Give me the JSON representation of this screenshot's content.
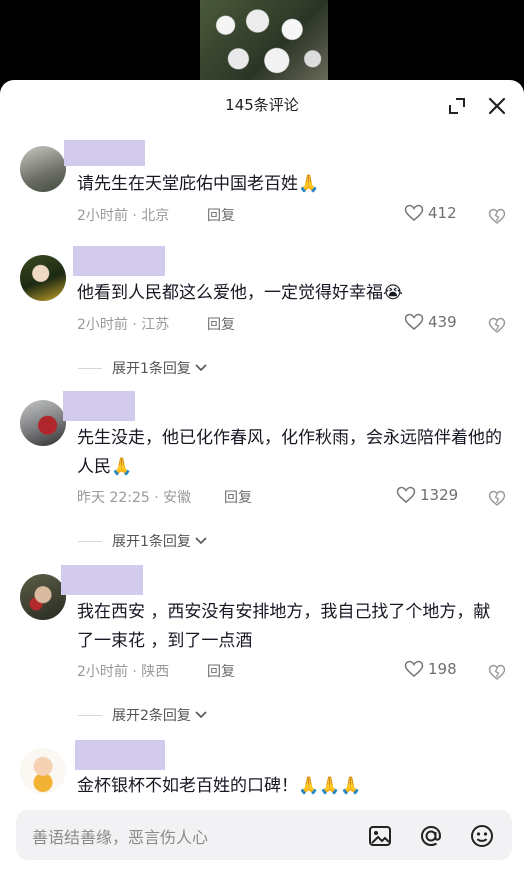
{
  "header": {
    "title": "145条评论"
  },
  "comments": [
    {
      "text": "请先生在天堂庇佑中国老百姓",
      "emoji": "🙏",
      "time_location": "2小时前 · 北京",
      "reply": "回复",
      "likes": "412"
    },
    {
      "text": "他看到人民都这么爱他，一定觉得好幸福",
      "emoji": "😭",
      "time_location": "2小时前 · 江苏",
      "reply": "回复",
      "likes": "439",
      "expand": "展开1条回复"
    },
    {
      "text": "先生没走，他已化作春风，化作秋雨，会永远陪伴着他的人民",
      "emoji": "🙏",
      "time_location": "昨天 22:25 · 安徽",
      "reply": "回复",
      "likes": "1329",
      "expand": "展开1条回复"
    },
    {
      "text": "我在西安 ，西安没有安排地方，我自己找了个地方，献了一束花 ，到了一点酒",
      "emoji": "",
      "time_location": "2小时前 · 陕西",
      "reply": "回复",
      "likes": "198",
      "expand": "展开2条回复"
    },
    {
      "text": "金杯银杯不如老百姓的口碑！",
      "emoji": "🙏🙏🙏",
      "time_location": "",
      "reply": "",
      "likes": ""
    }
  ],
  "input": {
    "placeholder": "善语结善缘，恶言伤人心"
  },
  "icons": [
    "expand-icon",
    "close-icon",
    "heart-icon",
    "dislike-icon",
    "image-icon",
    "at-icon",
    "emoji-icon",
    "chevron-down-icon"
  ],
  "colors": {
    "username_redaction": "#d3cbee",
    "text": "#161823",
    "meta": "#9a9a9a"
  }
}
